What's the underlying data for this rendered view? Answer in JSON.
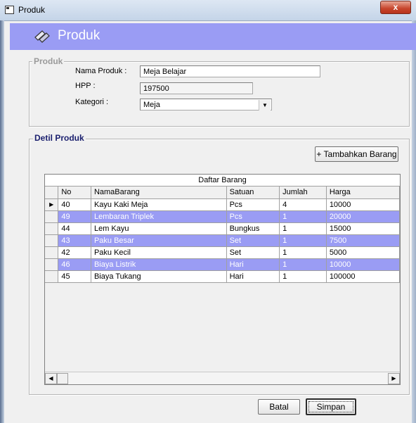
{
  "window": {
    "title": "Produk",
    "close_label": "x"
  },
  "header": {
    "title": "Produk"
  },
  "produk_group": {
    "legend": "Produk",
    "nama_label": "Nama Produk :",
    "nama_value": "Meja Belajar",
    "hpp_label": "HPP :",
    "hpp_value": "197500",
    "kategori_label": "Kategori :",
    "kategori_value": "Meja"
  },
  "detil_group": {
    "legend": "Detil Produk",
    "add_button": "+ Tambahkan Barang"
  },
  "grid": {
    "caption": "Daftar Barang",
    "columns": [
      "No",
      "NamaBarang",
      "Satuan",
      "Jumlah",
      "Harga"
    ],
    "rows": [
      [
        "40",
        "Kayu Kaki Meja",
        "Pcs",
        "4",
        "10000"
      ],
      [
        "49",
        "Lembaran Triplek",
        "Pcs",
        "1",
        "20000"
      ],
      [
        "44",
        "Lem Kayu",
        "Bungkus",
        "1",
        "15000"
      ],
      [
        "43",
        "Paku Besar",
        "Set",
        "1",
        "7500"
      ],
      [
        "42",
        "Paku Kecil",
        "Set",
        "1",
        "5000"
      ],
      [
        "46",
        "Biaya Listrik",
        "Hari",
        "1",
        "10000"
      ],
      [
        "45",
        "Biaya Tukang",
        "Hari",
        "1",
        "100000"
      ]
    ],
    "current_row_indicator": "▶"
  },
  "footer": {
    "batal": "Batal",
    "simpan": "Simpan"
  },
  "colors": {
    "accent": "#9a9cf4"
  }
}
